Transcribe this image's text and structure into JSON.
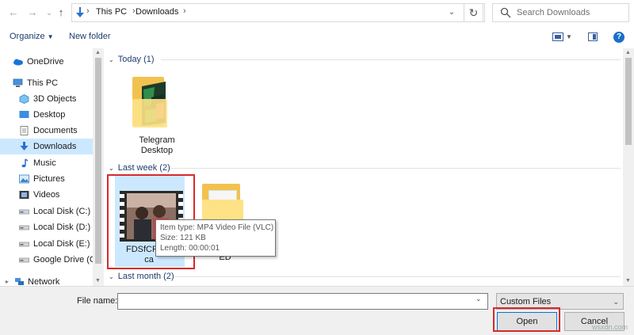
{
  "address": {
    "segments": [
      "This PC",
      "Downloads"
    ]
  },
  "search": {
    "placeholder": "Search Downloads"
  },
  "toolbar": {
    "organize_label": "Organize",
    "new_folder_label": "New folder",
    "help_label": "?"
  },
  "nav": {
    "items": [
      {
        "label": "OneDrive"
      },
      {
        "label": "This PC"
      },
      {
        "label": "3D Objects"
      },
      {
        "label": "Desktop"
      },
      {
        "label": "Documents"
      },
      {
        "label": "Downloads"
      },
      {
        "label": "Music"
      },
      {
        "label": "Pictures"
      },
      {
        "label": "Videos"
      },
      {
        "label": "Local Disk (C:)"
      },
      {
        "label": "Local Disk (D:)"
      },
      {
        "label": "Local Disk (E:)"
      },
      {
        "label": "Google Drive (G:"
      },
      {
        "label": "Network"
      }
    ]
  },
  "groups": [
    {
      "label": "Today (1)"
    },
    {
      "label": "Last week (2)"
    },
    {
      "label": "Last month (2)"
    }
  ],
  "files": {
    "telegram": {
      "line1": "Telegram",
      "line2": "Desktop"
    },
    "video": {
      "line1": "FDSfCPEW",
      "line2": "ca"
    },
    "folder2": {
      "line1": "ED"
    }
  },
  "tooltip": {
    "type_line": "Item type: MP4 Video File (VLC)",
    "size_line": "Size: 121 KB",
    "length_line": "Length: 00:00:01"
  },
  "bottom": {
    "filename_label": "File name:",
    "filename_value": "",
    "filetype_value": "Custom Files",
    "open_label": "Open",
    "cancel_label": "Cancel"
  },
  "watermark": "wsxdn.com",
  "colors": {
    "accent": "#0078d7",
    "selection": "#cce8ff",
    "highlight": "#d92a2a"
  }
}
